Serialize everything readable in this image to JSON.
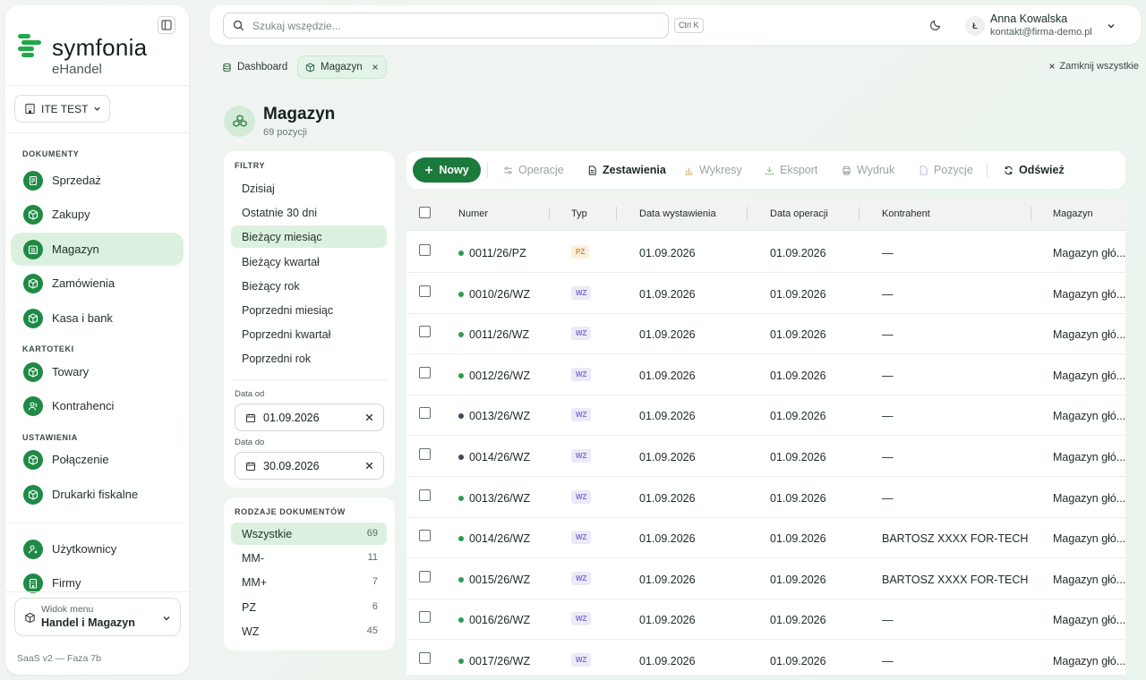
{
  "app": {
    "brand": "symfonia",
    "product": "eHandel",
    "company": "ITE TEST",
    "version": "SaaS v2 — Faza 7b"
  },
  "sidebar": {
    "sections": [
      {
        "title": "DOKUMENTY",
        "items": [
          "Sprzedaż",
          "Zakupy",
          "Magazyn",
          "Zamówienia",
          "Kasa i bank"
        ]
      },
      {
        "title": "KARTOTEKI",
        "items": [
          "Towary",
          "Kontrahenci"
        ]
      },
      {
        "title": "USTAWIENIA",
        "items": [
          "Połączenie",
          "Drukarki fiskalne"
        ]
      }
    ],
    "extra": [
      "Użytkownicy",
      "Firmy"
    ],
    "active": "Magazyn",
    "menu_view": {
      "label": "Widok menu",
      "value": "Handel i Magazyn"
    }
  },
  "topbar": {
    "search_placeholder": "Szukaj wszędzie...",
    "shortcut": "Ctrl K",
    "user_initial": "Ł",
    "user_name": "Anna Kowalska",
    "user_email": "kontakt@firma-demo.pl"
  },
  "tabs": [
    "Dashboard",
    "Magazyn"
  ],
  "close_all": "Zamknij wszystkie",
  "page": {
    "title": "Magazyn",
    "subtitle": "69 pozycji"
  },
  "filters": {
    "title": "FILTRY",
    "periods": [
      "Dzisiaj",
      "Ostatnie 30 dni",
      "Bieżący miesiąc",
      "Bieżący kwartał",
      "Bieżący rok",
      "Poprzedni miesiąc",
      "Poprzedni kwartał",
      "Poprzedni rok"
    ],
    "active_period": "Bieżący miesiąc",
    "date_from_label": "Data od",
    "date_from": "01.09.2026",
    "date_to_label": "Data do",
    "date_to": "30.09.2026"
  },
  "doc_types": {
    "title": "RODZAJE DOKUMENTÓW",
    "items": [
      {
        "label": "Wszystkie",
        "count": "69"
      },
      {
        "label": "MM-",
        "count": "11"
      },
      {
        "label": "MM+",
        "count": "7"
      },
      {
        "label": "PZ",
        "count": "6"
      },
      {
        "label": "WZ",
        "count": "45"
      }
    ]
  },
  "toolbar": {
    "new": "Nowy",
    "operations": "Operacje",
    "reports": "Zestawienia",
    "charts": "Wykresy",
    "export": "Eksport",
    "print": "Wydruk",
    "positions": "Pozycje",
    "refresh": "Odśwież"
  },
  "table": {
    "columns": [
      "Numer",
      "Typ",
      "Data wystawienia",
      "Data operacji",
      "Kontrahent",
      "Magazyn"
    ],
    "rows": [
      {
        "numer": "0011/26/PZ",
        "typ": "PZ",
        "data_wyst": "01.09.2026",
        "data_op": "01.09.2026",
        "kontrahent": "—",
        "magazyn": "Magazyn głó...",
        "status": "green"
      },
      {
        "numer": "0010/26/WZ",
        "typ": "WZ",
        "data_wyst": "01.09.2026",
        "data_op": "01.09.2026",
        "kontrahent": "—",
        "magazyn": "Magazyn głó...",
        "status": "green"
      },
      {
        "numer": "0011/26/WZ",
        "typ": "WZ",
        "data_wyst": "01.09.2026",
        "data_op": "01.09.2026",
        "kontrahent": "—",
        "magazyn": "Magazyn głó...",
        "status": "green"
      },
      {
        "numer": "0012/26/WZ",
        "typ": "WZ",
        "data_wyst": "01.09.2026",
        "data_op": "01.09.2026",
        "kontrahent": "—",
        "magazyn": "Magazyn głó...",
        "status": "green"
      },
      {
        "numer": "0013/26/WZ",
        "typ": "WZ",
        "data_wyst": "01.09.2026",
        "data_op": "01.09.2026",
        "kontrahent": "—",
        "magazyn": "Magazyn głó...",
        "status": "dark"
      },
      {
        "numer": "0014/26/WZ",
        "typ": "WZ",
        "data_wyst": "01.09.2026",
        "data_op": "01.09.2026",
        "kontrahent": "—",
        "magazyn": "Magazyn głó...",
        "status": "dark"
      },
      {
        "numer": "0013/26/WZ",
        "typ": "WZ",
        "data_wyst": "01.09.2026",
        "data_op": "01.09.2026",
        "kontrahent": "—",
        "magazyn": "Magazyn głó...",
        "status": "green"
      },
      {
        "numer": "0014/26/WZ",
        "typ": "WZ",
        "data_wyst": "01.09.2026",
        "data_op": "01.09.2026",
        "kontrahent": "BARTOSZ XXXX FOR-TECH",
        "magazyn": "Magazyn głó...",
        "status": "green"
      },
      {
        "numer": "0015/26/WZ",
        "typ": "WZ",
        "data_wyst": "01.09.2026",
        "data_op": "01.09.2026",
        "kontrahent": "BARTOSZ XXXX FOR-TECH",
        "magazyn": "Magazyn głó...",
        "status": "green"
      },
      {
        "numer": "0016/26/WZ",
        "typ": "WZ",
        "data_wyst": "01.09.2026",
        "data_op": "01.09.2026",
        "kontrahent": "—",
        "magazyn": "Magazyn głó...",
        "status": "green"
      },
      {
        "numer": "0017/26/WZ",
        "typ": "WZ",
        "data_wyst": "01.09.2026",
        "data_op": "01.09.2026",
        "kontrahent": "—",
        "magazyn": "Magazyn głó...",
        "status": "green"
      }
    ]
  },
  "colors": {
    "accent": "#1c7a3c",
    "active_bg": "#dcf0e0",
    "status_green": "#2e9a52",
    "status_dark": "#3a4a5c"
  },
  "icons": {
    "search": "search-icon",
    "moon": "moon-icon",
    "chevron": "chevron-down-icon",
    "close": "close-icon",
    "calendar": "calendar-icon",
    "box": "box-icon"
  }
}
